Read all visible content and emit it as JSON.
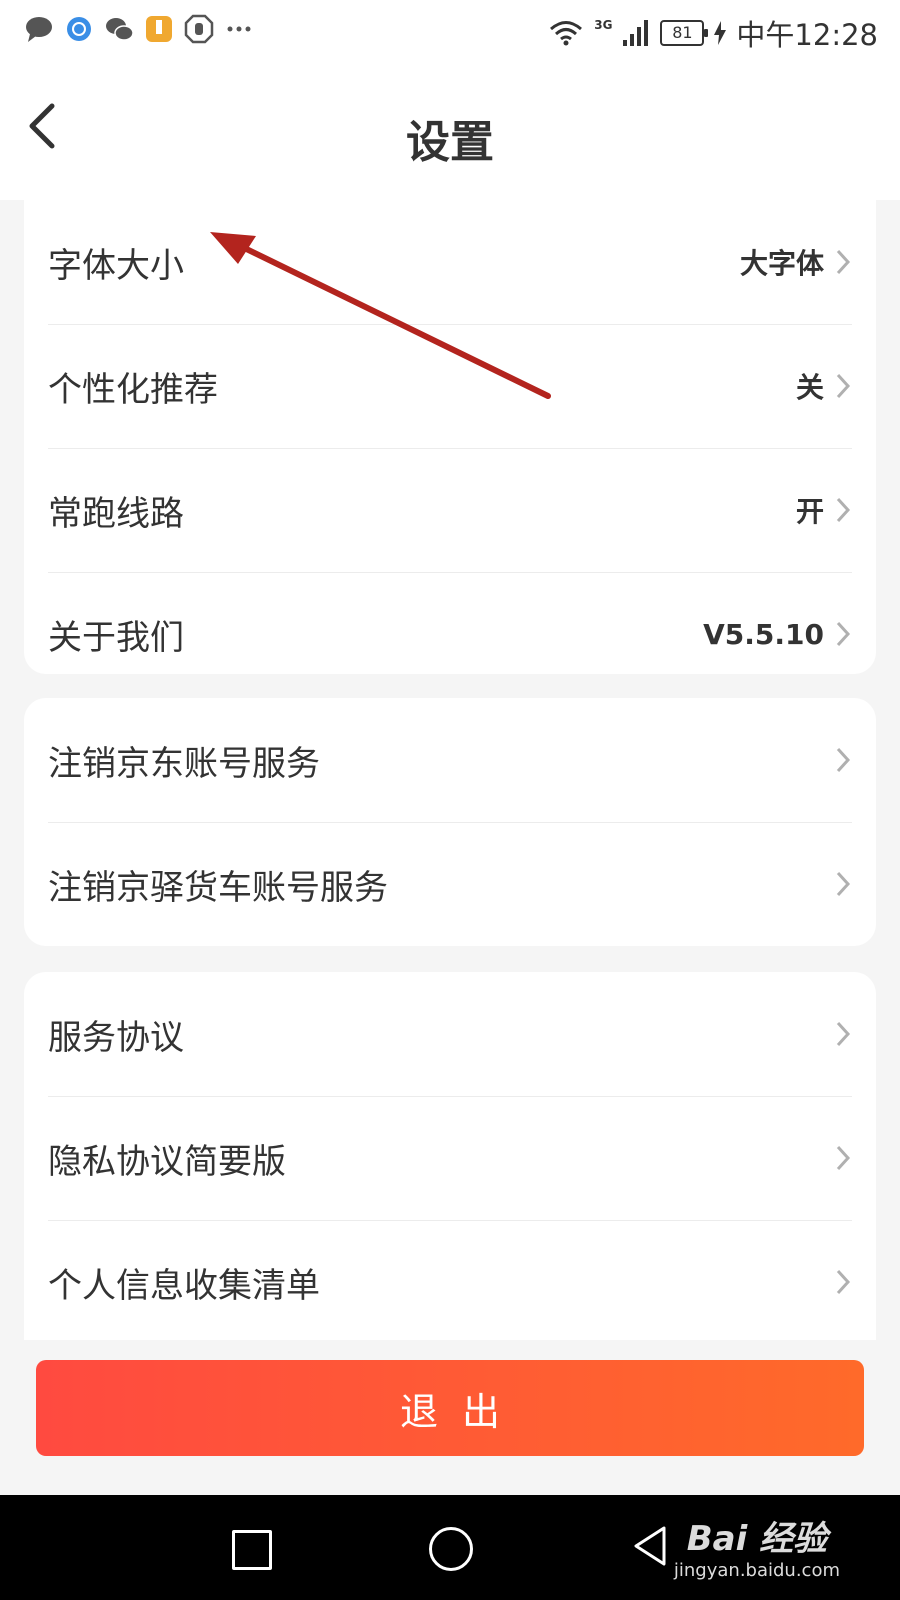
{
  "status_bar": {
    "time": "中午12:28",
    "battery": "81",
    "network": "3G"
  },
  "header": {
    "title": "设置"
  },
  "sections": [
    {
      "items": [
        {
          "label": "字体大小",
          "value": "大字体"
        },
        {
          "label": "个性化推荐",
          "value": "关"
        },
        {
          "label": "常跑线路",
          "value": "开"
        },
        {
          "label": "关于我们",
          "value": "V5.5.10"
        }
      ]
    },
    {
      "items": [
        {
          "label": "注销京东账号服务",
          "value": ""
        },
        {
          "label": "注销京驿货车账号服务",
          "value": ""
        }
      ]
    },
    {
      "items": [
        {
          "label": "服务协议",
          "value": ""
        },
        {
          "label": "隐私协议简要版",
          "value": ""
        },
        {
          "label": "个人信息收集清单",
          "value": ""
        }
      ]
    }
  ],
  "logout_label": "退出",
  "watermark": {
    "brand": "Bai 经验",
    "url": "jingyan.baidu.com"
  },
  "colors": {
    "logout_start": "#ff4a40",
    "logout_end": "#ff6a2a",
    "annotation_arrow": "#b3241e"
  }
}
